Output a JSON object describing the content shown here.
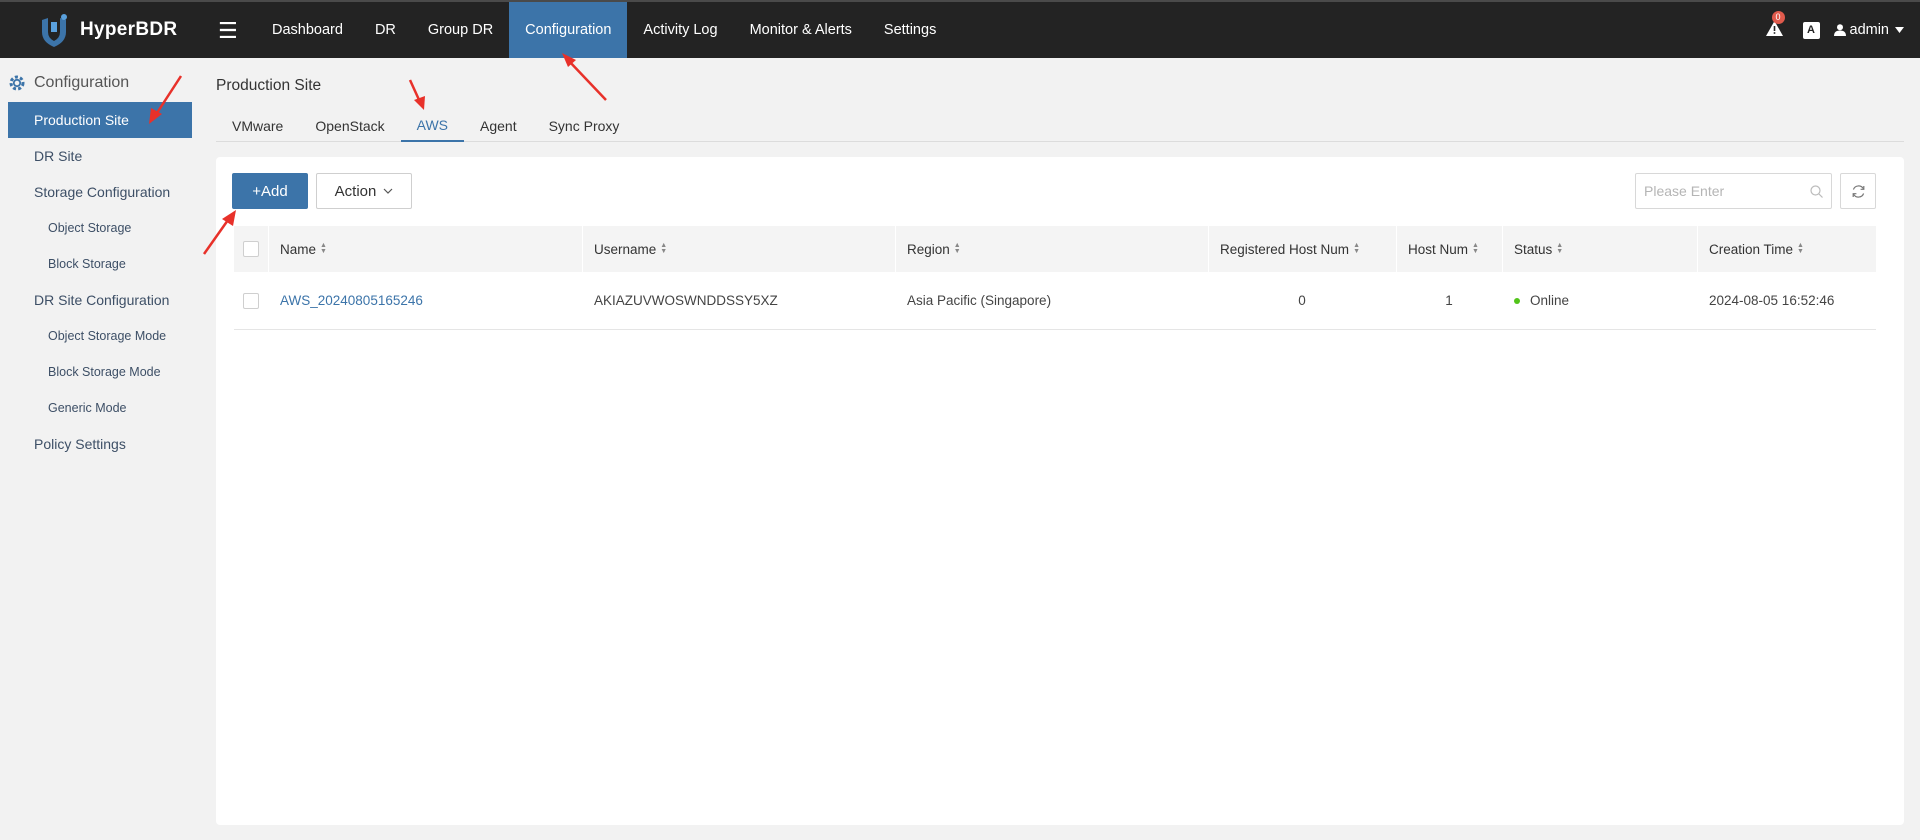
{
  "app": {
    "name": "HyperBDR"
  },
  "nav": {
    "items": [
      {
        "label": "Dashboard",
        "active": false
      },
      {
        "label": "DR",
        "active": false
      },
      {
        "label": "Group DR",
        "active": false
      },
      {
        "label": "Configuration",
        "active": true
      },
      {
        "label": "Activity Log",
        "active": false
      },
      {
        "label": "Monitor & Alerts",
        "active": false
      },
      {
        "label": "Settings",
        "active": false
      }
    ],
    "alert_count": "0",
    "lang_icon_text": "A",
    "user": "admin"
  },
  "sidebar": {
    "title": "Configuration",
    "items": [
      {
        "label": "Production Site",
        "active": true
      },
      {
        "label": "DR Site"
      },
      {
        "label": "Storage Configuration"
      },
      {
        "label": "Object Storage"
      },
      {
        "label": "Block Storage"
      },
      {
        "label": "DR Site Configuration"
      },
      {
        "label": "Object Storage Mode"
      },
      {
        "label": "Block Storage Mode"
      },
      {
        "label": "Generic Mode"
      },
      {
        "label": "Policy Settings"
      }
    ]
  },
  "main": {
    "title": "Production Site",
    "tabs": [
      {
        "label": "VMware"
      },
      {
        "label": "OpenStack"
      },
      {
        "label": "AWS",
        "active": true
      },
      {
        "label": "Agent"
      },
      {
        "label": "Sync Proxy"
      }
    ],
    "add_label": "+Add",
    "action_label": "Action",
    "search_placeholder": "Please Enter"
  },
  "table": {
    "columns": [
      "Name",
      "Username",
      "Region",
      "Registered Host Num",
      "Host Num",
      "Status",
      "Creation Time"
    ],
    "rows": [
      {
        "name": "AWS_20240805165246",
        "username": "AKIAZUVWOSWNDDSSY5XZ",
        "region": "Asia Pacific (Singapore)",
        "registered_host_num": "0",
        "host_num": "1",
        "status": "Online",
        "creation_time": "2024-08-05 16:52:46"
      }
    ]
  },
  "colors": {
    "topbar": "#232323",
    "accent": "#3c74a9",
    "online": "#52c41a",
    "annotation_arrow": "#e8312a"
  }
}
